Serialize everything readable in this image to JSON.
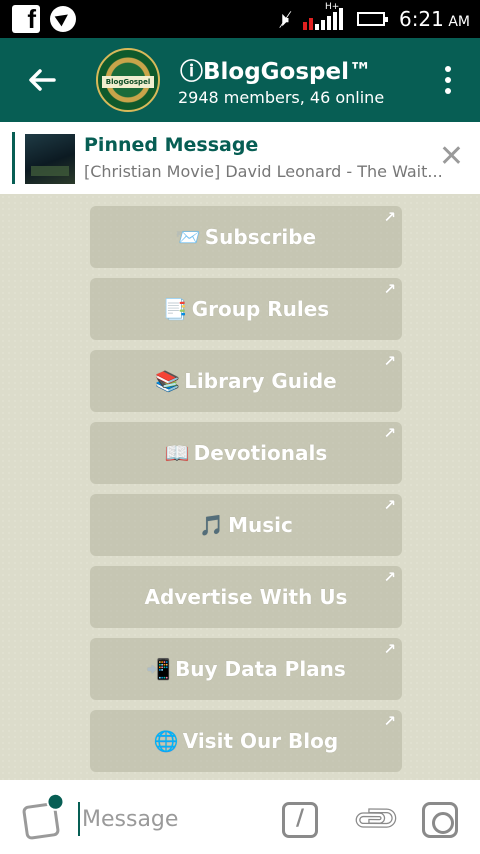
{
  "statusbar": {
    "time": "6:21",
    "ampm": "AM",
    "network": "H+",
    "icons": [
      "facebook-icon",
      "telegram-icon",
      "mute-icon",
      "signal-icon",
      "battery-icon"
    ]
  },
  "header": {
    "title": "ⓘBlogGospel™",
    "subtitle": "2948 members, 46 online",
    "avatar_label": "BlogGospel",
    "color": "#075e54"
  },
  "pinned": {
    "title": "Pinned Message",
    "text": "[Christian Movie] David Leonard - The Wait..."
  },
  "buttons": [
    {
      "emoji": "📨",
      "label": "Subscribe"
    },
    {
      "emoji": "📑",
      "label": "Group Rules"
    },
    {
      "emoji": "📚",
      "label": "Library Guide"
    },
    {
      "emoji": "📖",
      "label": "Devotionals"
    },
    {
      "emoji": "🎵",
      "label": "Music"
    },
    {
      "emoji": "",
      "label": "Advertise With Us"
    },
    {
      "emoji": "📲",
      "label": "Buy Data Plans"
    },
    {
      "emoji": "🌐",
      "label": "Visit Our Blog"
    }
  ],
  "inputbar": {
    "placeholder": "Message",
    "command_label": "/"
  }
}
